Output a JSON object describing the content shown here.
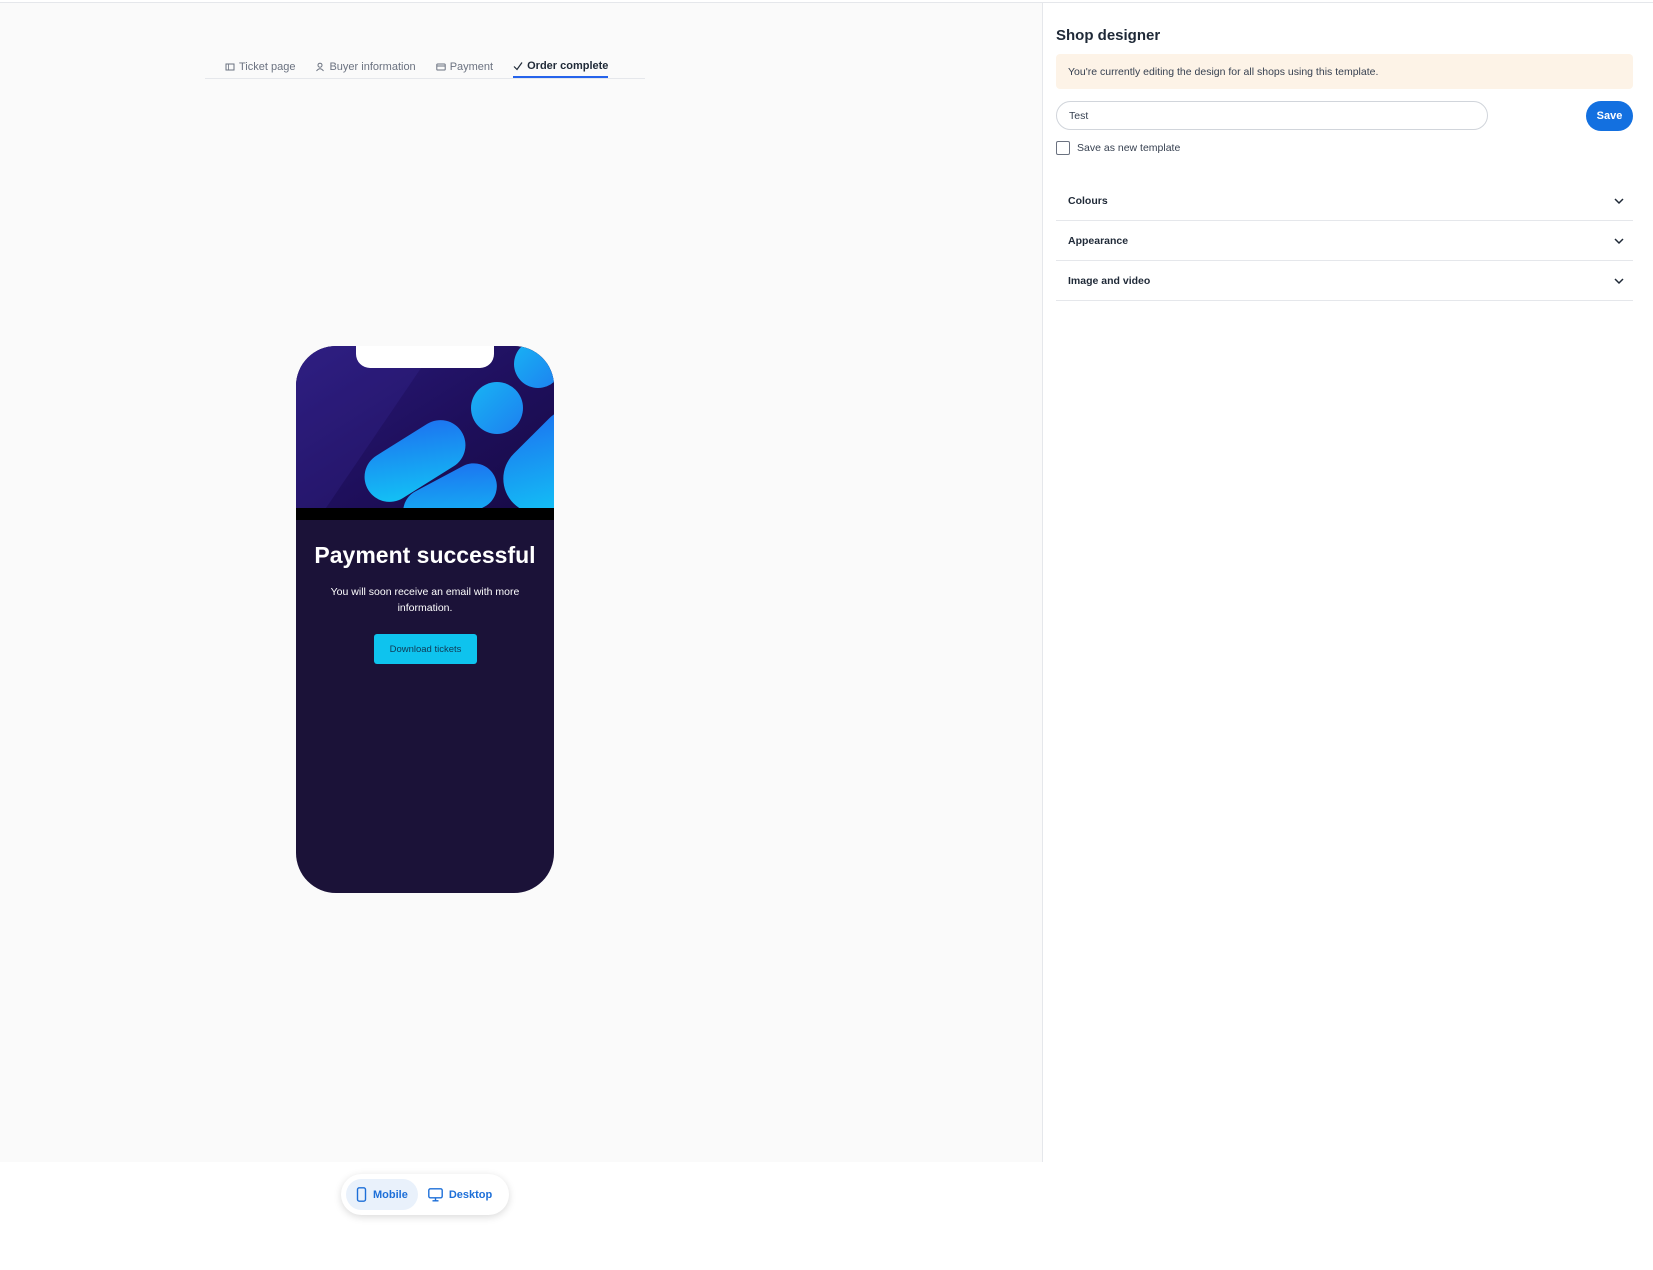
{
  "step_tabs": [
    {
      "label": "Ticket page",
      "icon": "ticket-icon",
      "active": false
    },
    {
      "label": "Buyer information",
      "icon": "user-icon",
      "active": false
    },
    {
      "label": "Payment",
      "icon": "credit-card-icon",
      "active": false
    },
    {
      "label": "Order complete",
      "icon": "check-icon",
      "active": true
    }
  ],
  "preview": {
    "title": "Payment successful",
    "subtitle": "You will soon receive an email with more information.",
    "cta_label": "Download tickets",
    "colors": {
      "background": "#1b1238",
      "cta": "#0ec3ee",
      "hero_dark": "#1e0f5c",
      "hero_accent": "#16c0f3"
    }
  },
  "device_toggle": {
    "mobile_label": "Mobile",
    "desktop_label": "Desktop",
    "selected": "Mobile"
  },
  "panel": {
    "title": "Shop designer",
    "notice": "You're currently editing the design for all shops using this template.",
    "template_name_value": "Test",
    "save_label": "Save",
    "save_as_new_label": "Save as new template",
    "save_as_new_checked": false,
    "sections": [
      {
        "label": "Colours"
      },
      {
        "label": "Appearance"
      },
      {
        "label": "Image and video"
      }
    ],
    "accent_color": "#1370e0",
    "notice_bg": "#fdf3e7"
  }
}
